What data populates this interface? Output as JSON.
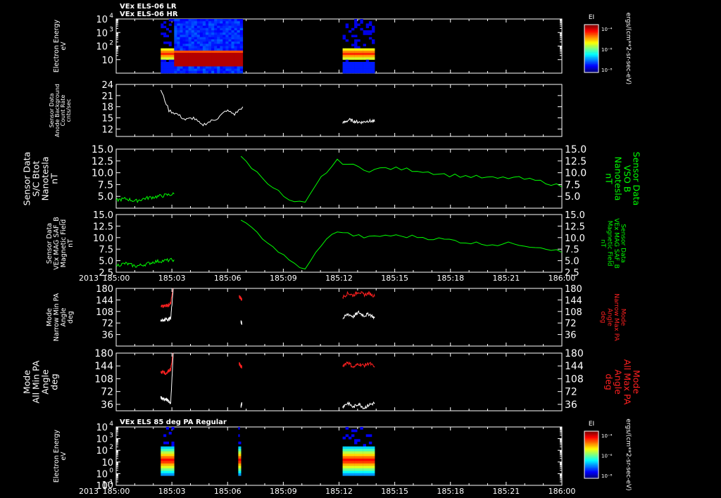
{
  "chart_data": [
    {
      "type": "heatmap",
      "id": "p1",
      "titles": [
        "VEx ELS-06 LR",
        "VEx ELS-06 HR"
      ],
      "ylabel": [
        "Electron Energy",
        "eV"
      ],
      "yscale": "log",
      "ylim": [
        1,
        10000
      ],
      "ytick_exponents": [
        1,
        2,
        3,
        4
      ],
      "colorbar": {
        "label": "EI",
        "ticks": [
          "10⁻⁴",
          "10⁻⁶",
          "10⁻⁸"
        ],
        "units": "ergs/(cm**2-sr-sec-eV)"
      },
      "segments": [
        {
          "x": [
            185.05,
            185.065
          ],
          "style": "lr"
        },
        {
          "x": [
            185.065,
            185.142
          ],
          "style": "hr"
        },
        {
          "x": [
            185.254,
            185.29
          ],
          "style": "lr"
        }
      ]
    },
    {
      "type": "line",
      "id": "p2",
      "ylabel": [
        "Sensor Data",
        "Anode Background",
        "Count Rate",
        "cnts/sec"
      ],
      "ylim": [
        10,
        24
      ],
      "yticks": [
        12,
        15,
        18,
        21,
        24
      ],
      "series": [
        {
          "color": "#ffffff",
          "segments": [
            {
              "x": [
                185.05,
                185.142
              ],
              "y": [
                22.5,
                17,
                16,
                14.5,
                15,
                13,
                14,
                15,
                17,
                16,
                18
              ]
            },
            {
              "x": [
                185.254,
                185.29
              ],
              "y": [
                13.5,
                14.5,
                14,
                13.8,
                14.2,
                14
              ]
            }
          ]
        }
      ]
    },
    {
      "type": "line",
      "id": "p3",
      "ylabel": [
        "Sensor Data",
        "S/C Btot",
        "Nanotesla",
        "nT"
      ],
      "ylabel_right": [
        "Sensor Data",
        "VSO B",
        "Nanotesla",
        "nT"
      ],
      "ylim": [
        2.5,
        15
      ],
      "yticks": [
        5.0,
        7.5,
        10.0,
        12.5,
        15.0
      ],
      "series": [
        {
          "color": "#00ff00",
          "segments": [
            {
              "x": [
                185.0,
                185.065
              ],
              "y": [
                4.2,
                4.5,
                4.0,
                4.6,
                4.9,
                5.2,
                5.5
              ]
            },
            {
              "x": [
                185.14,
                185.5
              ],
              "y": [
                13.5,
                10,
                7,
                4,
                3.5,
                9,
                12.5,
                11.5,
                10.5,
                11,
                10.8,
                10.5,
                10,
                9.5,
                9.3,
                9,
                8.8,
                9,
                8.5,
                8.0,
                7.0
              ]
            }
          ]
        }
      ]
    },
    {
      "type": "line",
      "id": "p4",
      "ylabel": [
        "Sensor Data",
        "VEx MAG SAF_B",
        "Magnetic Field",
        "nT"
      ],
      "ylabel_right": [
        "Sensor Data",
        "VEx MAG SAF_B",
        "Magnetic Field",
        "nT"
      ],
      "ylim": [
        2.5,
        15
      ],
      "yticks": [
        2.5,
        5.0,
        7.5,
        10.0,
        12.5,
        15.0
      ],
      "x_year_label": "2013",
      "xticks": [
        "185:00",
        "185:03",
        "185:06",
        "185:09",
        "185:12",
        "185:15",
        "185:18",
        "185:21",
        "186:00"
      ],
      "series": [
        {
          "color": "#00ff00",
          "segments": [
            {
              "x": [
                185.0,
                185.065
              ],
              "y": [
                4.0,
                4.4,
                3.8,
                4.2,
                4.8,
                5.0,
                5.2
              ]
            },
            {
              "x": [
                185.14,
                185.5
              ],
              "y": [
                13.8,
                11,
                8,
                5,
                3.0,
                8.5,
                11.5,
                10.5,
                10,
                10.5,
                10.3,
                10.2,
                9.8,
                9.5,
                9.0,
                8.7,
                8.5,
                8.8,
                8.2,
                7.8,
                6.8
              ]
            }
          ]
        }
      ]
    },
    {
      "type": "line",
      "id": "p5",
      "ylabel": [
        "Mode",
        "Narrow Min PA",
        "Angle",
        "deg"
      ],
      "ylabel_right": [
        "Mode",
        "Narrow Max PA",
        "Angle",
        "deg"
      ],
      "ylim": [
        0,
        180
      ],
      "yticks": [
        36,
        72,
        108,
        144,
        180
      ],
      "series": [
        {
          "color": "#ff2020",
          "segments": [
            {
              "x": [
                185.05,
                185.064
              ],
              "y": [
                125,
                122,
                128,
                126,
                135,
                180
              ]
            },
            {
              "x": [
                185.138,
                185.141
              ],
              "y": [
                155,
                145
              ]
            },
            {
              "x": [
                185.254,
                185.29
              ],
              "y": [
                152,
                165,
                158,
                170,
                160,
                165,
                155
              ]
            }
          ]
        },
        {
          "color": "#ffffff",
          "segments": [
            {
              "x": [
                185.05,
                185.064
              ],
              "y": [
                82,
                80,
                84,
                83,
                88,
                180
              ]
            },
            {
              "x": [
                185.14,
                185.141
              ],
              "y": [
                76,
                70
              ]
            },
            {
              "x": [
                185.254,
                185.29
              ],
              "y": [
                85,
                100,
                92,
                105,
                95,
                100,
                88
              ]
            }
          ]
        }
      ]
    },
    {
      "type": "line",
      "id": "p6",
      "ylabel": [
        "Mode",
        "All Min PA",
        "Angle",
        "deg"
      ],
      "ylabel_right": [
        "Mode",
        "All Max PA",
        "Angle",
        "deg"
      ],
      "ylim": [
        18,
        180
      ],
      "yticks": [
        36,
        72,
        108,
        144,
        180
      ],
      "series": [
        {
          "color": "#ff2020",
          "segments": [
            {
              "x": [
                185.05,
                185.064
              ],
              "y": [
                125,
                128,
                122,
                130,
                135,
                180
              ]
            },
            {
              "x": [
                185.138,
                185.141
              ],
              "y": [
                150,
                140
              ]
            },
            {
              "x": [
                185.254,
                185.29
              ],
              "y": [
                145,
                155,
                140,
                150,
                145,
                152,
                140
              ]
            }
          ]
        },
        {
          "color": "#ffffff",
          "segments": [
            {
              "x": [
                185.05,
                185.064
              ],
              "y": [
                55,
                50,
                52,
                45,
                40,
                180
              ]
            },
            {
              "x": [
                185.14,
                185.141
              ],
              "y": [
                30,
                40
              ]
            },
            {
              "x": [
                185.254,
                185.29
              ],
              "y": [
                30,
                40,
                28,
                38,
                26,
                35,
                40
              ]
            }
          ]
        }
      ]
    },
    {
      "type": "heatmap",
      "id": "p7",
      "titles": [
        "VEx ELS 85 deg PA Regular"
      ],
      "ylabel": [
        "Electron Energy",
        "eV"
      ],
      "yscale": "log",
      "ylim": [
        0.1,
        10000
      ],
      "ytick_exponents": [
        -1,
        0,
        1,
        2,
        3,
        4
      ],
      "bottom_tick": "10",
      "colorbar": {
        "label": "EI",
        "ticks": [
          "10⁻⁴",
          "10⁻⁶",
          "10⁻⁸"
        ],
        "units": "ergs/(cm**2-sr-sec-eV)"
      },
      "x_year_label": "2013",
      "xticks": [
        "185:00",
        "185:03",
        "185:06",
        "185:09",
        "185:12",
        "185:15",
        "185:18",
        "185:21",
        "186:00"
      ],
      "segments": [
        {
          "x": [
            185.05,
            185.065
          ],
          "style": "pa"
        },
        {
          "x": [
            185.137,
            185.14
          ],
          "style": "pa"
        },
        {
          "x": [
            185.254,
            185.29
          ],
          "style": "pa"
        }
      ]
    }
  ]
}
